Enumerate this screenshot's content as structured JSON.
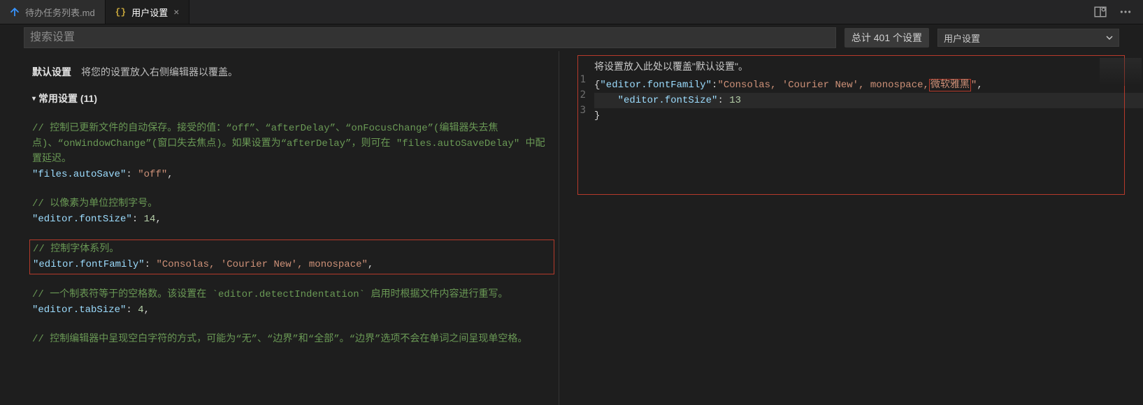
{
  "tabs": {
    "file": {
      "label": "待办任务列表.md"
    },
    "settings": {
      "label": "用户设置",
      "close_glyph": "×"
    }
  },
  "toolbar": {
    "search_placeholder": "搜索设置",
    "count_text": "总计 401 个设置",
    "scope": "用户设置"
  },
  "left": {
    "title": "默认设置",
    "subtitle": "将您的设置放入右侧编辑器以覆盖。",
    "section_label": "常用设置 (11)",
    "entries": [
      {
        "comment": "// 控制已更新文件的自动保存。接受的值：“off”、“afterDelay”、“onFocusChange”(编辑器失去焦点)、“onWindowChange”(窗口失去焦点)。如果设置为“afterDelay”，则可在 \"files.autoSaveDelay\" 中配置延迟。",
        "key": "\"files.autoSave\"",
        "value": "\"off\"",
        "value_is_string": true
      },
      {
        "comment": "// 以像素为单位控制字号。",
        "key": "\"editor.fontSize\"",
        "value": "14",
        "value_is_string": false
      },
      {
        "comment": "// 控制字体系列。",
        "key": "\"editor.fontFamily\"",
        "value": "\"Consolas, 'Courier New', monospace\"",
        "value_is_string": true,
        "highlighted": true
      },
      {
        "comment": "// 一个制表符等于的空格数。该设置在 `editor.detectIndentation` 启用时根据文件内容进行重写。",
        "key": "\"editor.tabSize\"",
        "value": "4",
        "value_is_string": false
      },
      {
        "comment": "// 控制编辑器中呈现空白字符的方式，可能为“无”、“边界”和“全部”。“边界”选项不会在单词之间呈现单空格。",
        "key": "",
        "value": "",
        "truncated": true
      }
    ]
  },
  "right": {
    "desc": "将设置放入此处以覆盖\"默认设置\"。",
    "gutter": [
      "1",
      "2",
      "3"
    ],
    "code": {
      "l1_open": "{",
      "l1_key": "\"editor.fontFamily\"",
      "l1_val_a": "\"Consolas, 'Courier New', monospace,",
      "l1_val_hl": "微软雅黑",
      "l1_val_b": "\"",
      "l1_tail": ",",
      "l2_key": "\"editor.fontSize\"",
      "l2_val": "13",
      "l3": "}"
    }
  }
}
